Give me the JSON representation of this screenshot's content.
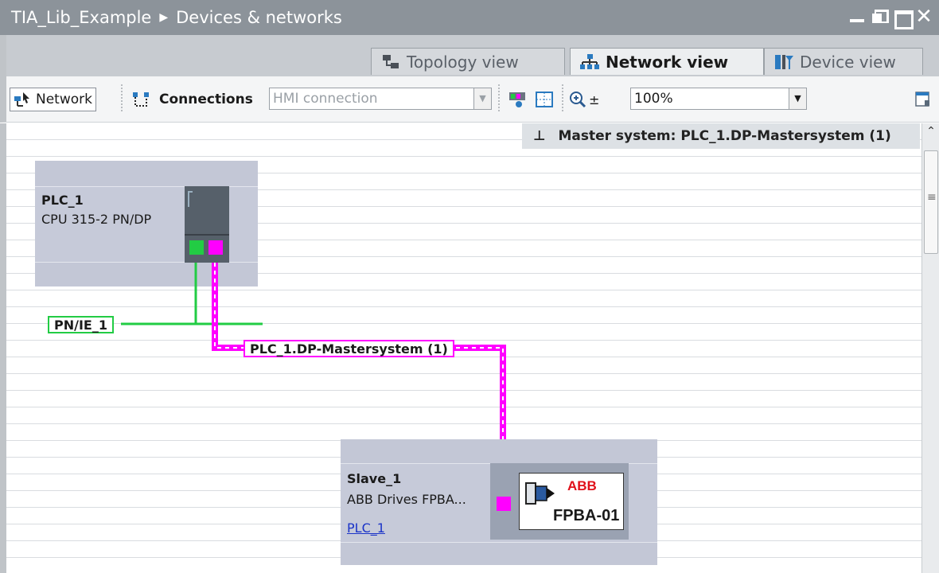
{
  "title": {
    "project": "TIA_Lib_Example",
    "separator": "▶",
    "page": "Devices & networks"
  },
  "tabs": [
    {
      "label": "Topology view",
      "icon": "topology-icon",
      "active": false
    },
    {
      "label": "Network view",
      "icon": "network-icon",
      "active": true
    },
    {
      "label": "Device view",
      "icon": "device-icon",
      "active": false
    }
  ],
  "toolbar": {
    "network_label": "Network",
    "connections_label": "Connections",
    "connection_type": "HMI connection",
    "zoom_value": "100%"
  },
  "master_banner": "Master system: PLC_1.DP-Mastersystem (1)",
  "devices": {
    "plc": {
      "name": "PLC_1",
      "type": "CPU 315-2 PN/DP"
    },
    "slave": {
      "name": "Slave_1",
      "type": "ABB Drives FPBA...",
      "link": "PLC_1",
      "module_label": "FPBA-01",
      "brand": "ABB"
    }
  },
  "networks": {
    "pnie": "PN/IE_1",
    "dp": "PLC_1.DP-Mastersystem (1)"
  },
  "colors": {
    "profinet": "#22cc44",
    "profibus": "#ff00ff",
    "device_bg": "#c3c7d6"
  }
}
